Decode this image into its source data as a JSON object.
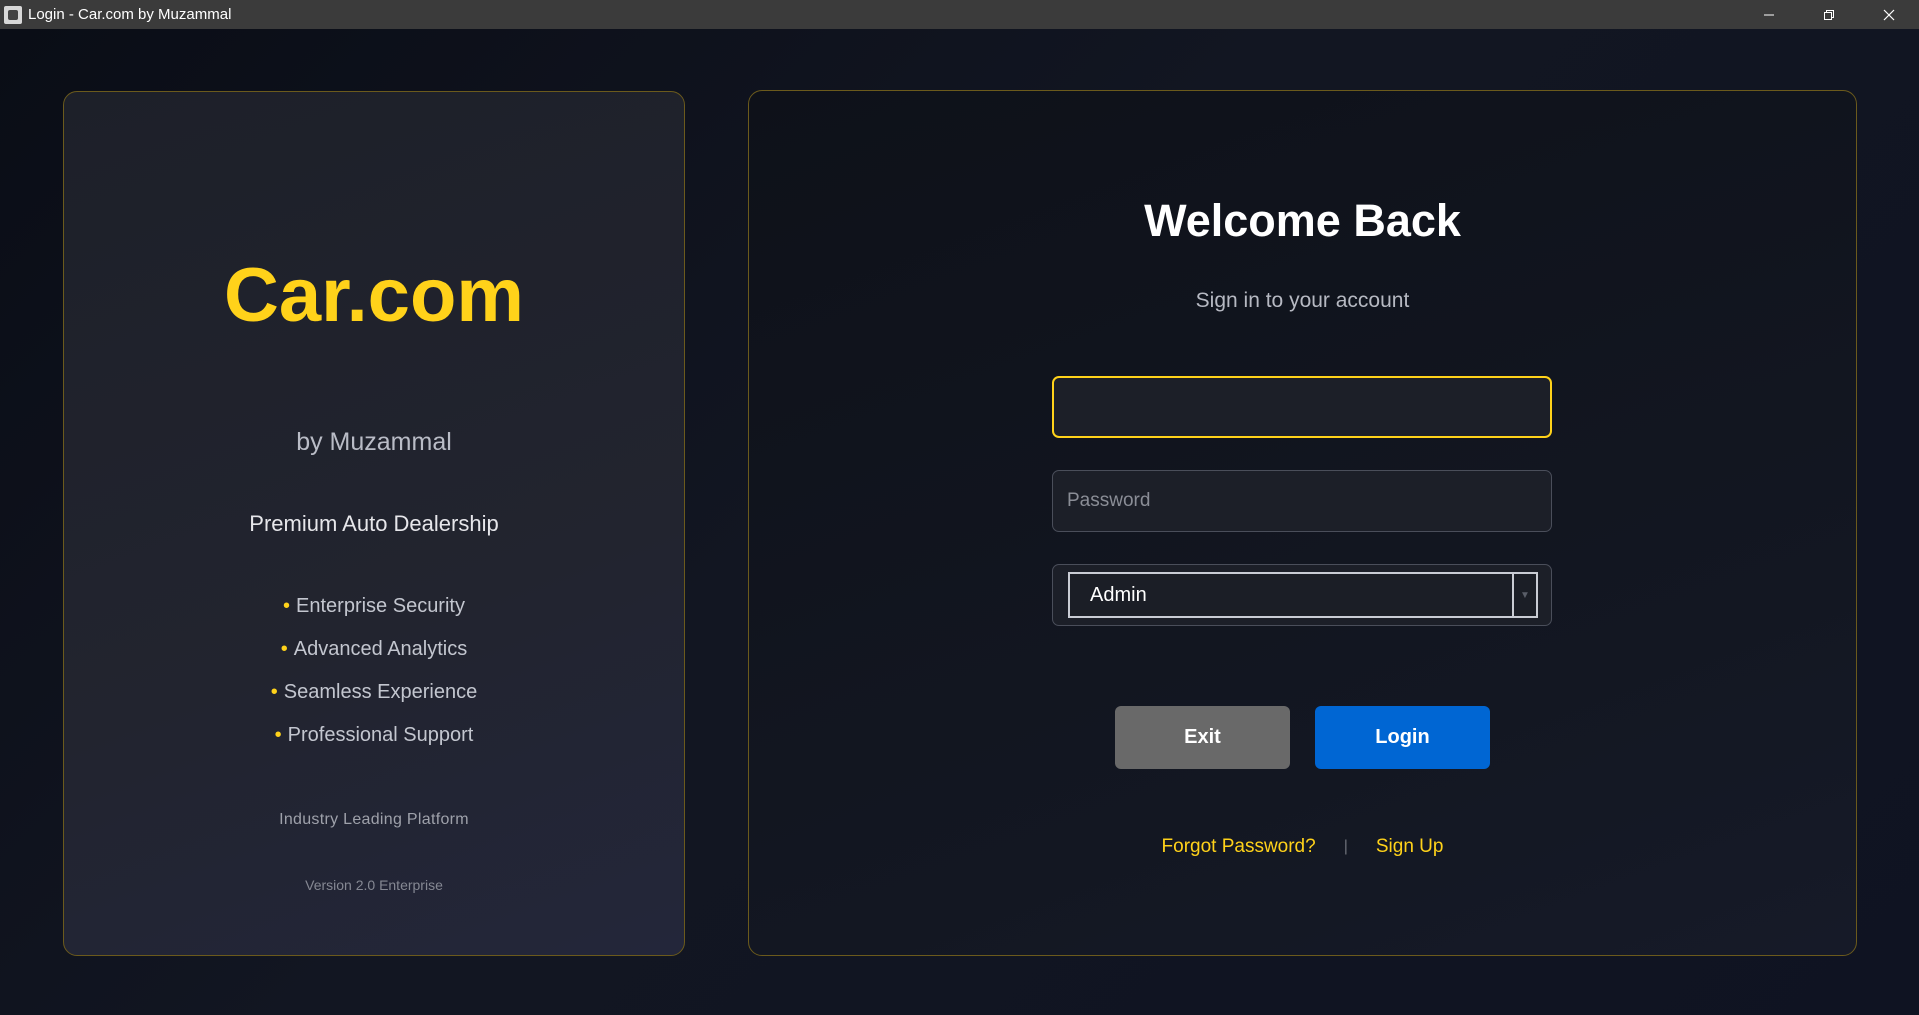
{
  "window": {
    "title": "Login - Car.com by Muzammal",
    "icons": {
      "app": "app-icon",
      "minimize": "minimize-icon",
      "restore": "restore-icon",
      "close": "close-icon"
    }
  },
  "brand_panel": {
    "brand": "Car.com",
    "byline": "by Muzammal",
    "tagline": "Premium Auto Dealership",
    "bullet": "•",
    "features": [
      "Enterprise Security",
      "Advanced Analytics",
      "Seamless Experience",
      "Professional Support"
    ],
    "platform": "Industry Leading Platform",
    "version": "Version 2.0 Enterprise"
  },
  "login_panel": {
    "heading": "Welcome Back",
    "subtitle": "Sign in to your account",
    "username": {
      "value": "",
      "placeholder": ""
    },
    "password": {
      "value": "",
      "placeholder": "Password"
    },
    "role": {
      "selected": "Admin"
    },
    "exit_label": "Exit",
    "login_label": "Login",
    "forgot_label": "Forgot Password?",
    "separator": "|",
    "signup_label": "Sign Up"
  },
  "colors": {
    "accent": "#ffd21a",
    "primary_button": "#0066d3",
    "secondary_button": "#696969",
    "background": "#0e111a"
  }
}
